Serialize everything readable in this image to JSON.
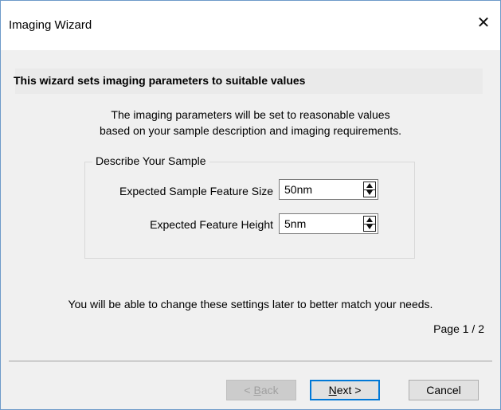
{
  "window": {
    "title": "Imaging Wizard",
    "close_glyph": "✕"
  },
  "header": {
    "text": "This wizard sets imaging parameters to suitable values"
  },
  "intro": {
    "line1": "The imaging parameters will be set to reasonable values",
    "line2": "based on your sample description and imaging requirements."
  },
  "sample_group": {
    "legend": "Describe Your Sample",
    "fields": [
      {
        "label": "Expected Sample Feature Size",
        "value": "50nm"
      },
      {
        "label": "Expected Feature Height",
        "value": "5nm"
      }
    ]
  },
  "footer": {
    "note": "You will be able to change these settings later to better match your needs.",
    "page_indicator": "Page 1 / 2"
  },
  "buttons": {
    "back": {
      "prefix": "< ",
      "mnemonic": "B",
      "rest": "ack",
      "enabled": false
    },
    "next": {
      "mnemonic": "N",
      "rest": "ext >",
      "enabled": true
    },
    "cancel": {
      "label": "Cancel",
      "enabled": true
    }
  },
  "colors": {
    "accent": "#0078d7",
    "window_border": "#6d9ac9"
  }
}
